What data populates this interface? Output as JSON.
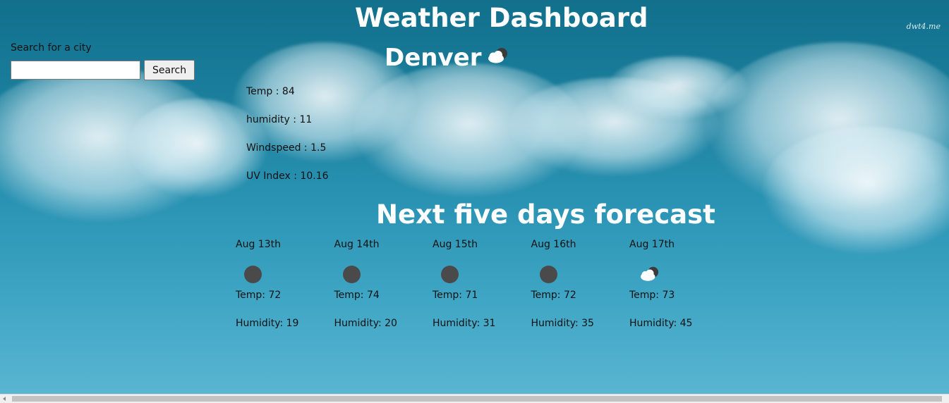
{
  "header": {
    "title": "Weather Dashboard",
    "watermark": "dwt4.me"
  },
  "search": {
    "label": "Search for a city",
    "value": "",
    "placeholder": "",
    "button_label": "Search"
  },
  "current": {
    "city": "Denver",
    "icon": "partly-cloudy-icon",
    "temp": "Temp : 84",
    "humidity": "humidity : 11",
    "windspeed": "Windspeed : 1.5",
    "uv": "UV Index : 10.16"
  },
  "forecast": {
    "title": "Next five days forecast",
    "days": [
      {
        "date": "Aug 13th",
        "icon": "clear-night-icon",
        "temp": "Temp: 72",
        "humidity": "Humidity: 19"
      },
      {
        "date": "Aug 14th",
        "icon": "clear-night-icon",
        "temp": "Temp: 74",
        "humidity": "Humidity: 20"
      },
      {
        "date": "Aug 15th",
        "icon": "clear-night-icon",
        "temp": "Temp: 71",
        "humidity": "Humidity: 31"
      },
      {
        "date": "Aug 16th",
        "icon": "clear-night-icon",
        "temp": "Temp: 72",
        "humidity": "Humidity: 35"
      },
      {
        "date": "Aug 17th",
        "icon": "partly-cloudy-icon",
        "temp": "Temp: 73",
        "humidity": "Humidity: 45"
      }
    ]
  },
  "colors": {
    "title_text": "#ffffff",
    "body_text": "#111111",
    "icon_dark": "#4a4a4a",
    "sky_top": "#11708c",
    "sky_bottom": "#5bb7d2"
  }
}
